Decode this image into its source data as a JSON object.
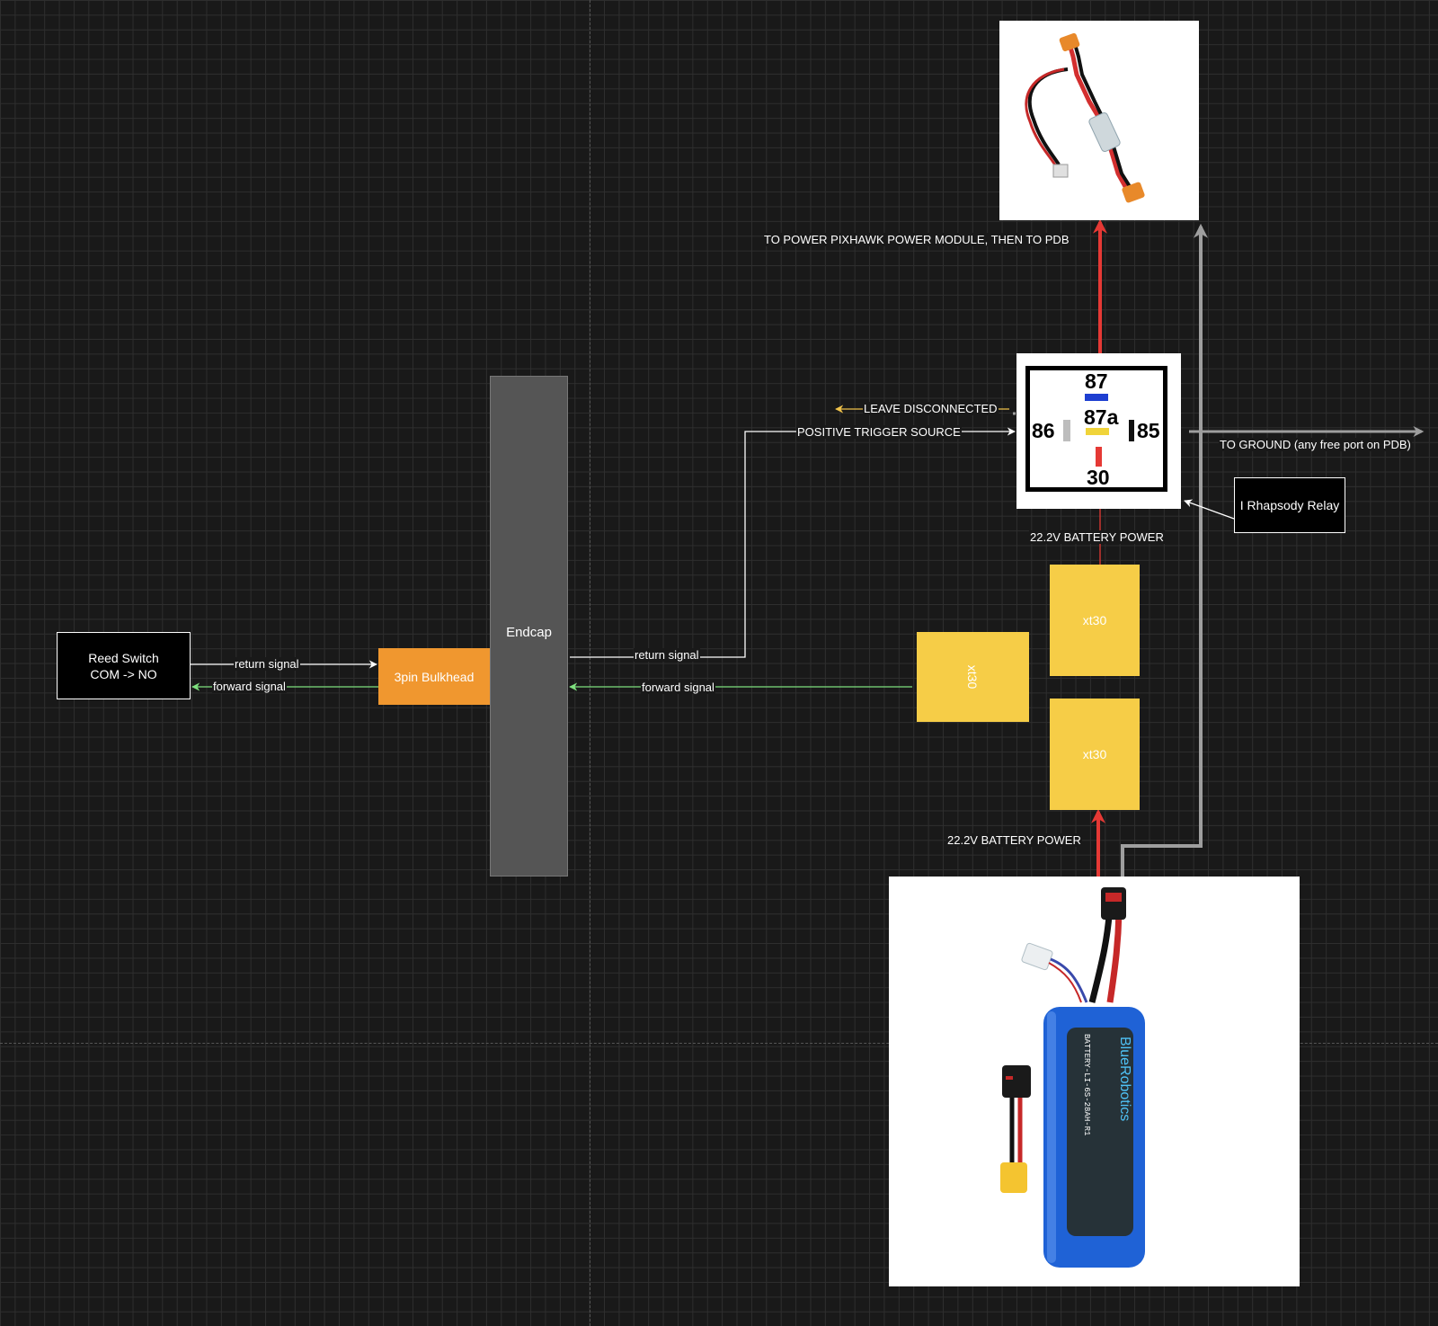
{
  "nodes": {
    "reed_switch": {
      "line1": "Reed Switch",
      "line2": "COM -> NO"
    },
    "bulkhead": "3pin Bulkhead",
    "endcap": "Endcap",
    "xt_top": "xt30",
    "xt_mid": "xt30",
    "xt_bot": "xt30",
    "relay_label": "I Rhapsody Relay"
  },
  "relay_pins": {
    "p87": "87",
    "p87a": "87a",
    "p86": "86",
    "p85": "85",
    "p30": "30"
  },
  "edge_labels": {
    "reed_return": "return signal",
    "reed_forward": "forward signal",
    "endcap_return": "return signal",
    "endcap_forward": "forward signal",
    "leave_disconnected": "LEAVE DISCONNECTED",
    "positive_trigger": "POSITIVE TRIGGER SOURCE",
    "to_power_module": "TO POWER PIXHAWK POWER MODULE, THEN TO PDB",
    "to_ground": "TO GROUND (any free port on PDB)",
    "battery_power_top": "22.2V BATTERY POWER",
    "battery_power_bottom": "22.2V BATTERY POWER"
  },
  "battery_image": {
    "brand": "BlueRobotics",
    "model": "BATTERY-LI-6S-28AH-R1"
  },
  "colors": {
    "power": "#e53935",
    "ground": "#9e9e9e",
    "forward_signal": "#7ee07e",
    "return_signal": "#ffffff",
    "disconnected": "#f0c24a",
    "bulkhead": "#f0972f",
    "connector": "#f6cd47",
    "endcap": "#555555"
  }
}
